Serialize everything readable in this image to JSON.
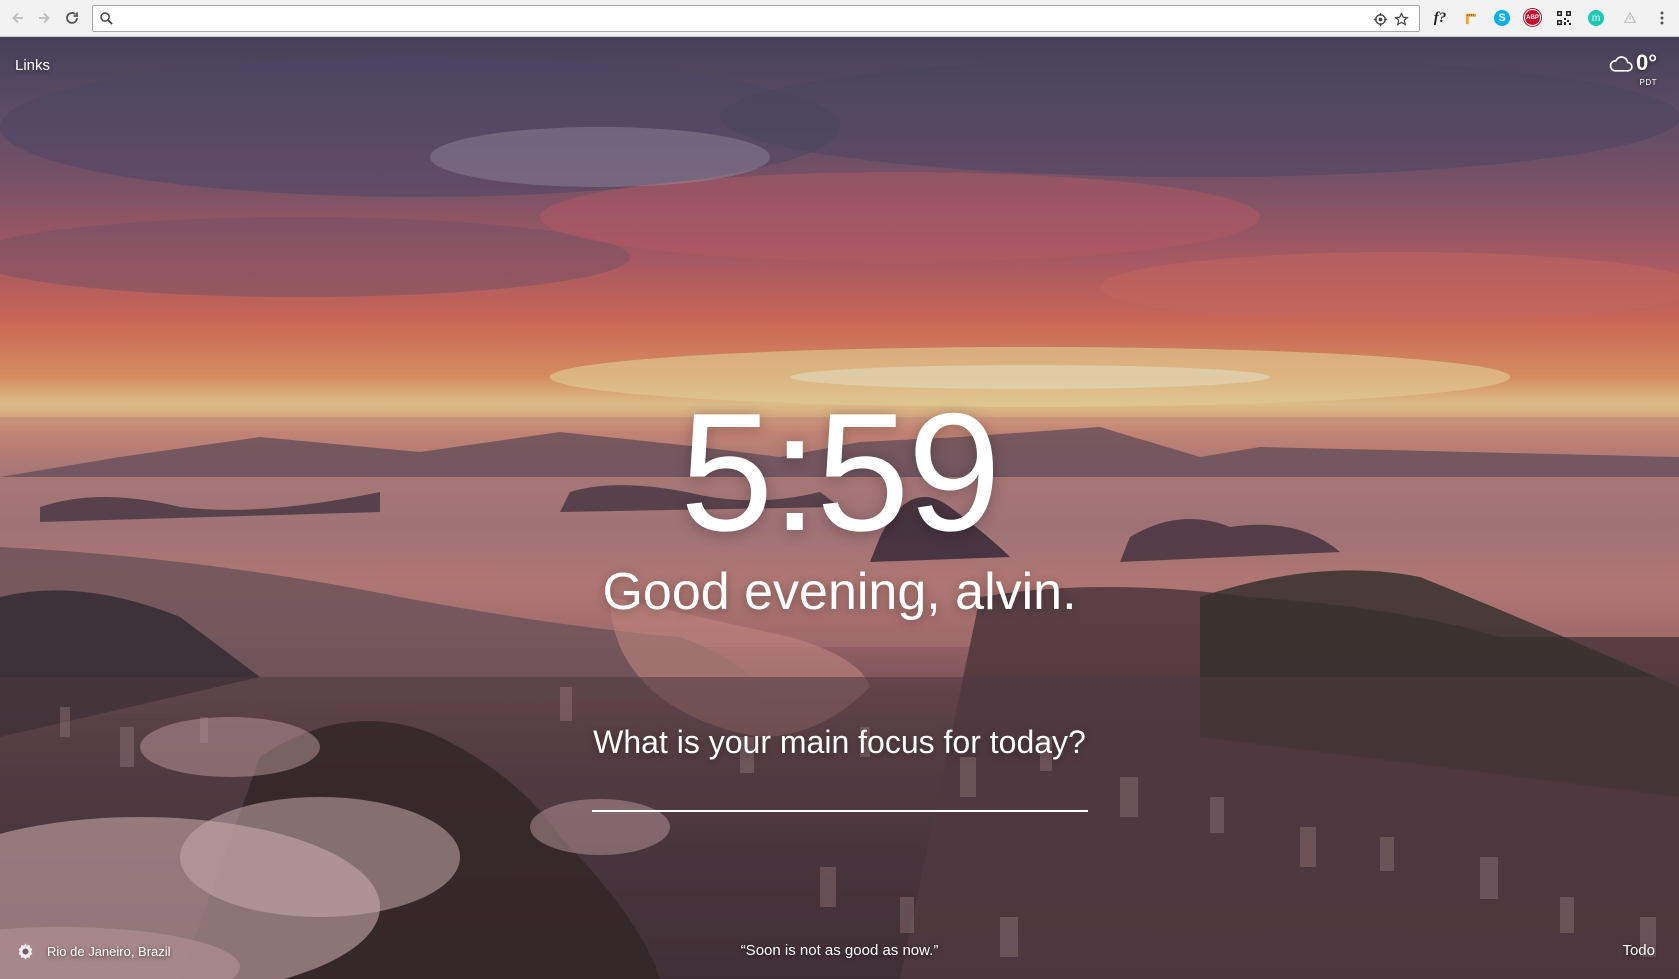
{
  "browser": {
    "address_value": "",
    "extensions": [
      "f?",
      "ABP",
      "m"
    ]
  },
  "momentum": {
    "links_label": "Links",
    "weather": {
      "temperature": "0°",
      "location": "PDT"
    },
    "time": "5:59",
    "greeting": "Good evening, alvin.",
    "focus_question": "What is your main focus for today?",
    "focus_value": "",
    "photo_location": "Rio de Janeiro, Brazil",
    "quote": "“Soon is not as good as now.”",
    "todo_label": "Todo"
  }
}
